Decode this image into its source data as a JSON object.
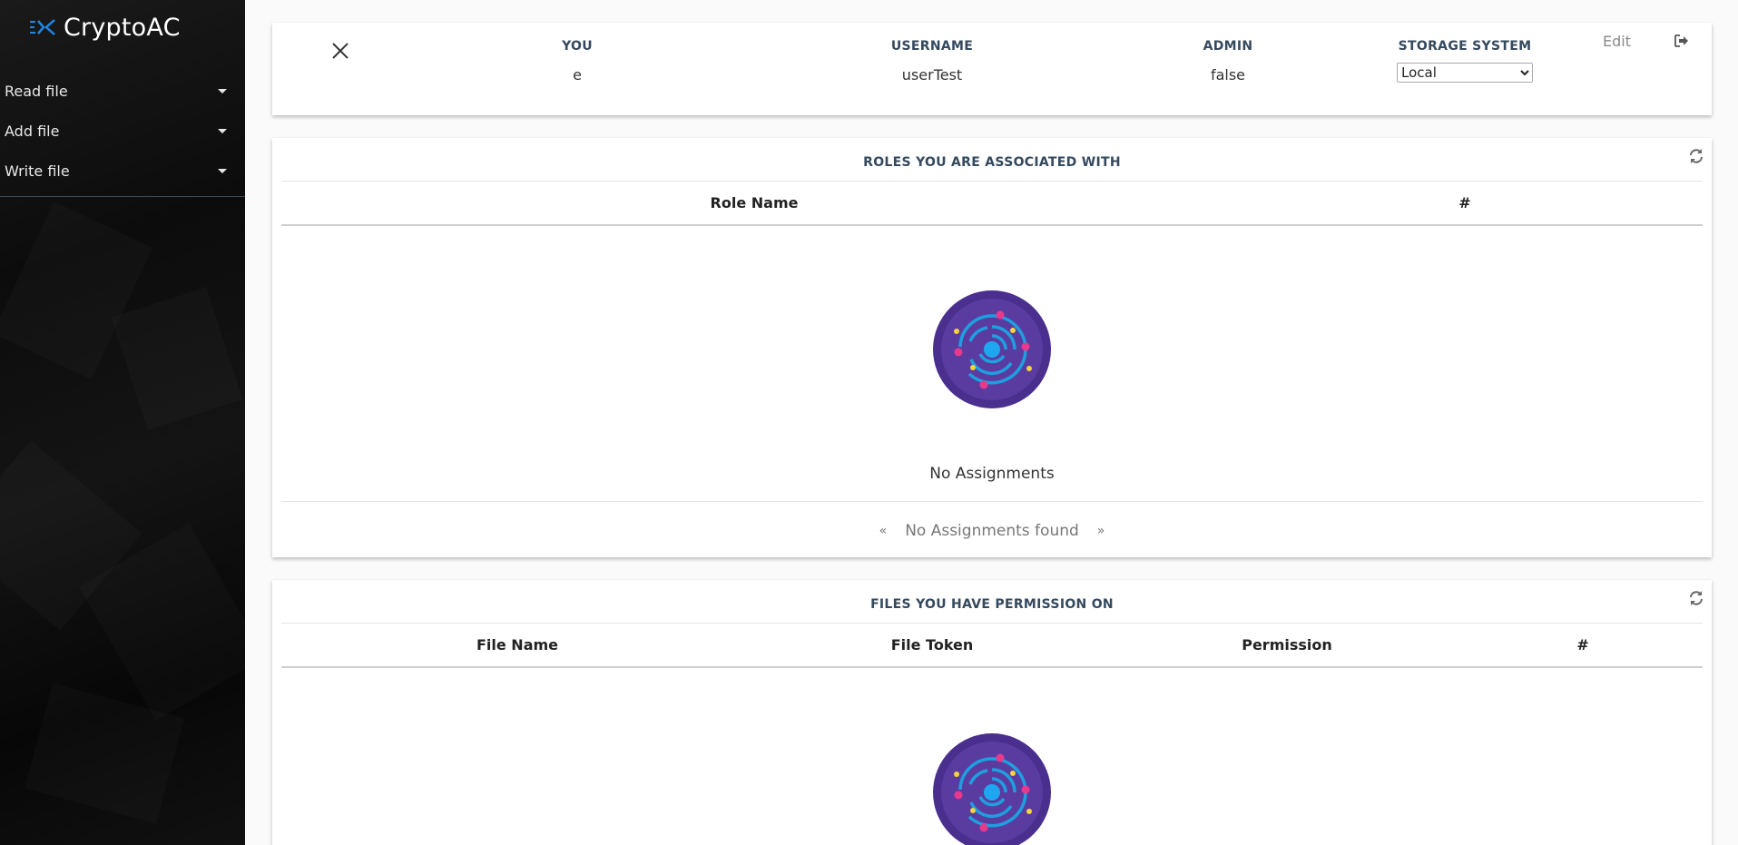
{
  "app": {
    "name": "CryptoAC"
  },
  "sidebar": {
    "items": [
      {
        "label": "Read file"
      },
      {
        "label": "Add file"
      },
      {
        "label": "Write file"
      }
    ]
  },
  "user_card": {
    "columns": {
      "you": {
        "label": "YOU",
        "value": "e"
      },
      "username": {
        "label": "USERNAME",
        "value": "userTest"
      },
      "admin": {
        "label": "ADMIN",
        "value": "false"
      },
      "storage": {
        "label": "STORAGE SYSTEM",
        "selected": "Local"
      }
    },
    "edit_label": "Edit"
  },
  "roles_section": {
    "title": "ROLES YOU ARE ASSOCIATED WITH",
    "columns": [
      "Role Name",
      "#"
    ],
    "empty_text": "No Assignments",
    "pager": {
      "prev": "«",
      "text": "No Assignments found",
      "next": "»"
    }
  },
  "files_section": {
    "title": "FILES YOU HAVE PERMISSION ON",
    "columns": [
      "File Name",
      "File Token",
      "Permission",
      "#"
    ]
  },
  "colors": {
    "accent_blue": "#1e88e5",
    "header_text": "#34495e",
    "galaxy_bg": "#4a2f8f"
  }
}
